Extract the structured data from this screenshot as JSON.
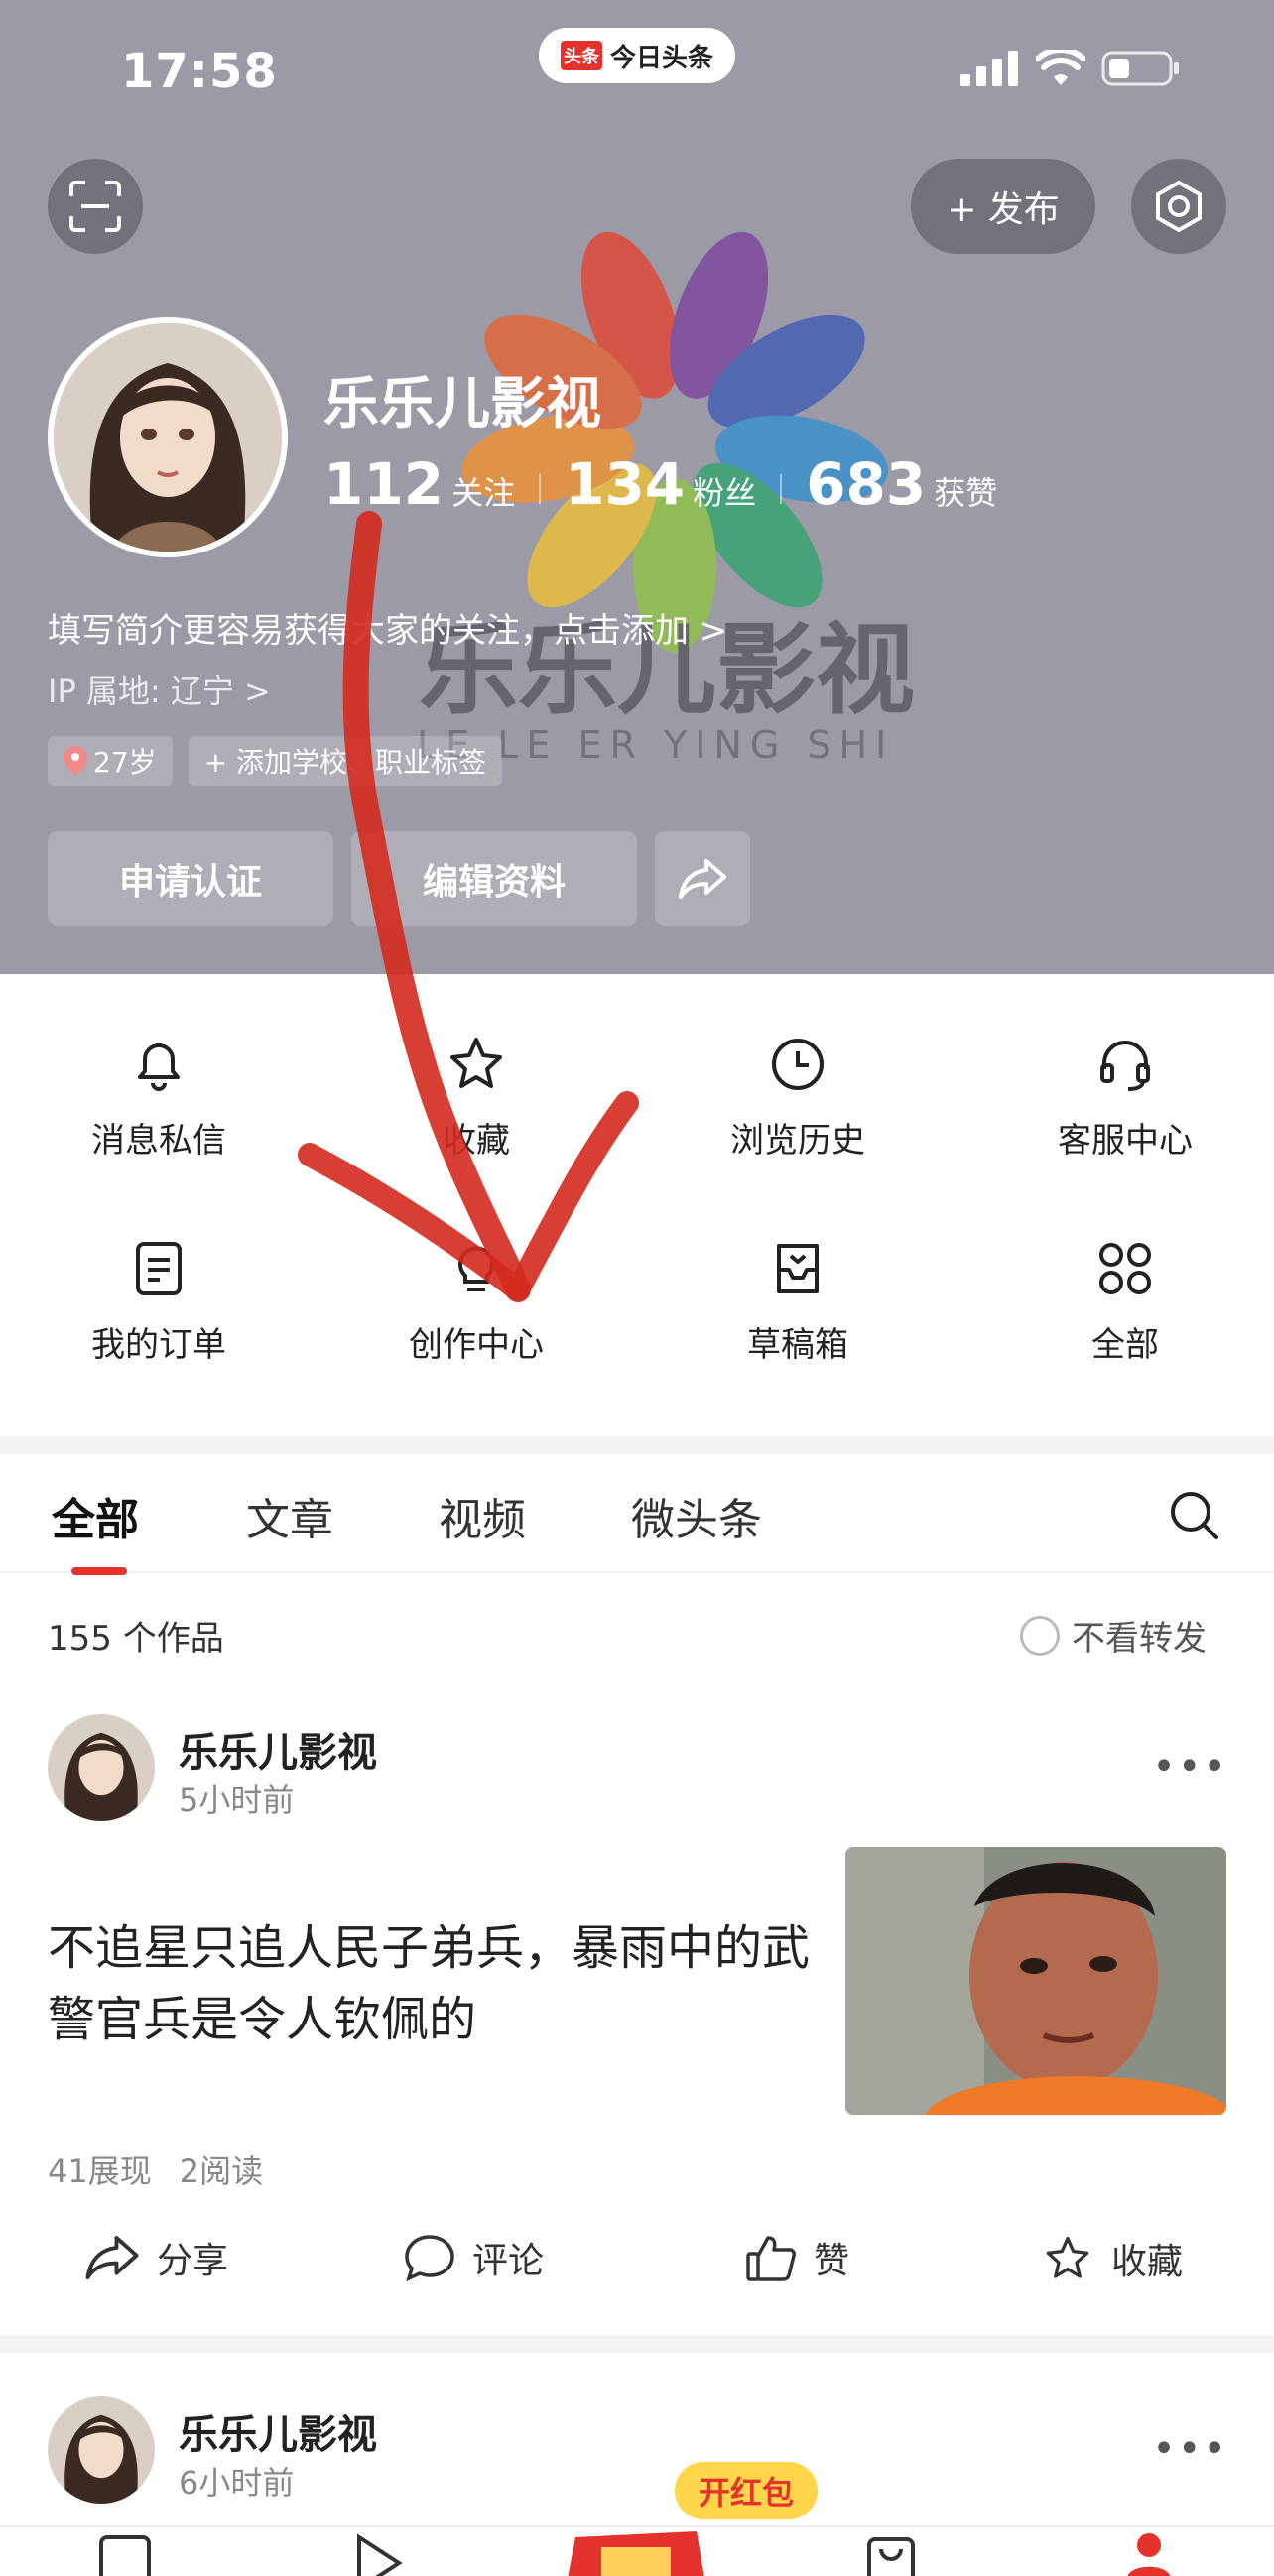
{
  "status_bar": {
    "time": "17:58",
    "island_logo": "头条",
    "island_text": "今日头条"
  },
  "header": {
    "publish_label": "+ 发布",
    "username": "乐乐儿影视",
    "stats": [
      {
        "value": "112",
        "label": "关注"
      },
      {
        "value": "134",
        "label": "粉丝"
      },
      {
        "value": "683",
        "label": "获赞"
      }
    ],
    "bio": "填写简介更容易获得大家的关注，点击添加 >",
    "ip": "IP 属地: 辽宁 >",
    "tags": {
      "age": "27岁",
      "add": "+ 添加学校、职业标签"
    },
    "buttons": {
      "verify": "申请认证",
      "edit": "编辑资料"
    },
    "watermark": {
      "text_cn": "乐乐儿影视",
      "text_en": "LE LE ER YING SHI"
    }
  },
  "menu": {
    "items": [
      {
        "label": "消息私信",
        "icon": "bell-icon"
      },
      {
        "label": "收藏",
        "icon": "star-icon"
      },
      {
        "label": "浏览历史",
        "icon": "clock-icon"
      },
      {
        "label": "客服中心",
        "icon": "headset-icon"
      },
      {
        "label": "我的订单",
        "icon": "order-icon"
      },
      {
        "label": "创作中心",
        "icon": "bulb-icon"
      },
      {
        "label": "草稿箱",
        "icon": "inbox-icon"
      },
      {
        "label": "全部",
        "icon": "grid-icon"
      }
    ]
  },
  "tabs": {
    "items": [
      "全部",
      "文章",
      "视频",
      "微头条"
    ],
    "active": "全部"
  },
  "works": {
    "count": "155 个作品",
    "filter_label": "不看转发"
  },
  "post1": {
    "author": "乐乐儿影视",
    "time": "5小时前",
    "title": "不追星只追人民子弟兵，暴雨中的武警官兵是令人钦佩的",
    "views": "41展现",
    "reads": "2阅读",
    "actions": {
      "share": "分享",
      "comment": "评论",
      "like": "赞",
      "fav": "收藏"
    }
  },
  "post2": {
    "author": "乐乐儿影视",
    "time": "6小时前"
  },
  "redpack_label": "开红包",
  "colors": {
    "accent": "#e5322d",
    "header_bg": "#9c9aa6",
    "arrow": "#d42a1e"
  }
}
